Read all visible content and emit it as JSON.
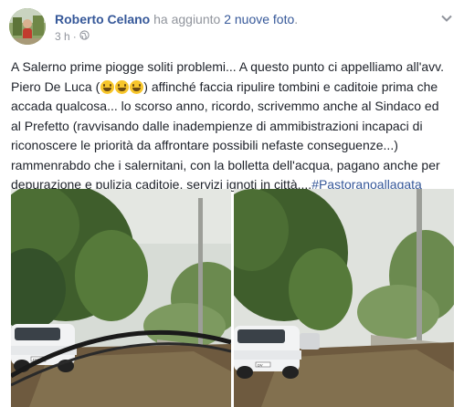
{
  "post": {
    "author": "Roberto Celano",
    "action_prefix": "ha aggiunto",
    "action_link": "2 nuove foto",
    "action_suffix": ".",
    "time": "3 h",
    "separator": "·",
    "audience_icon": "globe-icon",
    "menu_icon": "chevron-down-icon"
  },
  "text": {
    "l1": "A Salerno prime piogge soliti problemi... A questo punto ci appelliamo all'avv.",
    "l2a": "Piero De Luca (",
    "l2b": ") affinché faccia ripulire tombini e caditoie prima che",
    "l3": "accada qualcosa... lo scorso anno, ricordo, scrivemmo anche al Sindaco ed",
    "l4": "al Prefetto (ravvisando dalle inadempienze di ammibistrazioni incapaci di",
    "l5": "riconoscere le priorità da affrontare possibili nefaste conseguenze...)",
    "l6": "rammenrabdo che i salernitani, con la bolletta dell'acqua, pagano anche per",
    "l7": "depurazione e pulizia caditoie, servizi ignoti in città....",
    "hashtag": "#Pastoranoallagata",
    "emojis": [
      "winking-smile-emoji",
      "laughing-emoji",
      "laughing-emoji"
    ]
  },
  "photos": {
    "plate_left": "DV",
    "plate_right": "DV"
  },
  "colors": {
    "link": "#365899",
    "muted": "#90949c",
    "text": "#1d2129"
  }
}
